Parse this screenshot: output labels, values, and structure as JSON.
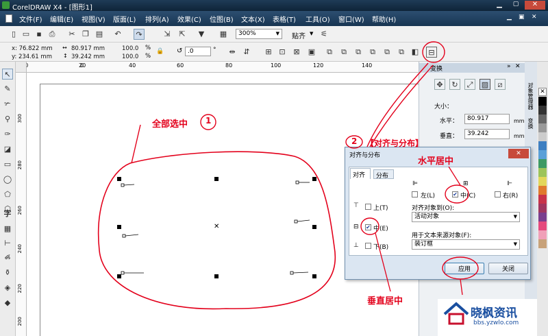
{
  "window": {
    "title": "CorelDRAW X4 - [图形1]"
  },
  "menu": [
    "文件(F)",
    "编辑(E)",
    "视图(V)",
    "版面(L)",
    "排列(A)",
    "效果(C)",
    "位图(B)",
    "文本(X)",
    "表格(T)",
    "工具(O)",
    "窗口(W)",
    "帮助(H)"
  ],
  "toolbar": {
    "zoom": "300%",
    "snap": "贴齐"
  },
  "props": {
    "x": "x: 76.822 mm",
    "y": "y: 234.61 mm",
    "w": "80.917 mm",
    "h": "39.242 mm",
    "sx": "100.0",
    "sy": "100.0",
    "pct": "%",
    "rot": ".0",
    "deg": "°"
  },
  "ruler_top": [
    "20",
    "0",
    "20",
    "40",
    "60",
    "80",
    "100",
    "120",
    "140"
  ],
  "ruler_left": [
    "300",
    "280",
    "260",
    "240",
    "220",
    "200"
  ],
  "docker": {
    "header": "变换",
    "size_label": "大小：",
    "h_label": "水平：",
    "h_value": "80.917",
    "v_label": "垂直：",
    "v_value": "39.242",
    "unit": "mm",
    "side_tabs": [
      "对象管理器",
      "变换"
    ]
  },
  "dialog": {
    "title": "对齐与分布",
    "tabs": [
      "对齐",
      "分布"
    ],
    "left": "左(L)",
    "center_h": "中(C)",
    "right": "右(R)",
    "top": "上(T)",
    "center_v": "中(E)",
    "bottom": "下(B)",
    "align_to_label": "对齐对象到(O):",
    "align_to_value": "活动对象",
    "text_source_label": "用于文本来源对象(F):",
    "text_source_value": "装订框",
    "apply": "应用",
    "close": "关闭"
  },
  "annotations": {
    "select_all": "全部选中",
    "num1": "1",
    "num2": "2",
    "align_dist": "【对齐与分布】",
    "h_center": "水平居中",
    "v_center": "垂直居中"
  },
  "watermark": {
    "name": "晓枫资讯",
    "url": "bbs.yzwlo.com"
  }
}
